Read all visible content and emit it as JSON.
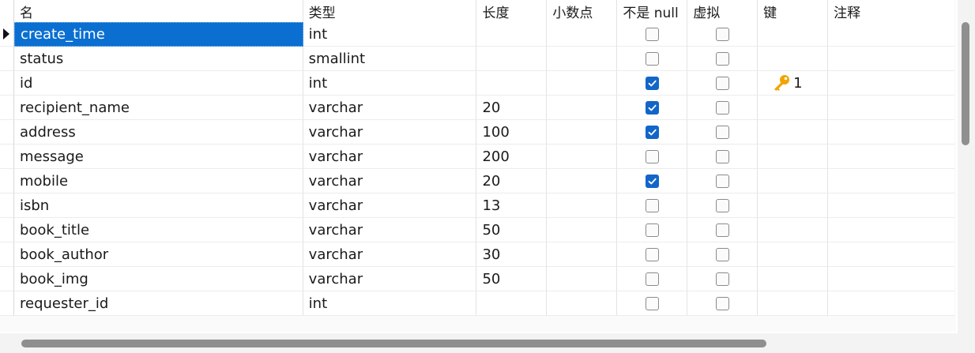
{
  "columns": {
    "name": "名",
    "type": "类型",
    "length": "长度",
    "decimals": "小数点",
    "not_null": "不是 null",
    "virtual": "虚拟",
    "key": "键",
    "comment": "注释"
  },
  "rows": [
    {
      "name": "create_time",
      "type": "int",
      "length": "",
      "decimals": "",
      "not_null": false,
      "virtual": false,
      "key": "",
      "comment": "",
      "selected": true
    },
    {
      "name": "status",
      "type": "smallint",
      "length": "",
      "decimals": "",
      "not_null": false,
      "virtual": false,
      "key": "",
      "comment": ""
    },
    {
      "name": "id",
      "type": "int",
      "length": "",
      "decimals": "",
      "not_null": true,
      "virtual": false,
      "key": "1",
      "comment": ""
    },
    {
      "name": "recipient_name",
      "type": "varchar",
      "length": "20",
      "decimals": "",
      "not_null": true,
      "virtual": false,
      "key": "",
      "comment": ""
    },
    {
      "name": "address",
      "type": "varchar",
      "length": "100",
      "decimals": "",
      "not_null": true,
      "virtual": false,
      "key": "",
      "comment": ""
    },
    {
      "name": "message",
      "type": "varchar",
      "length": "200",
      "decimals": "",
      "not_null": false,
      "virtual": false,
      "key": "",
      "comment": ""
    },
    {
      "name": "mobile",
      "type": "varchar",
      "length": "20",
      "decimals": "",
      "not_null": true,
      "virtual": false,
      "key": "",
      "comment": ""
    },
    {
      "name": "isbn",
      "type": "varchar",
      "length": "13",
      "decimals": "",
      "not_null": false,
      "virtual": false,
      "key": "",
      "comment": ""
    },
    {
      "name": "book_title",
      "type": "varchar",
      "length": "50",
      "decimals": "",
      "not_null": false,
      "virtual": false,
      "key": "",
      "comment": ""
    },
    {
      "name": "book_author",
      "type": "varchar",
      "length": "30",
      "decimals": "",
      "not_null": false,
      "virtual": false,
      "key": "",
      "comment": ""
    },
    {
      "name": "book_img",
      "type": "varchar",
      "length": "50",
      "decimals": "",
      "not_null": false,
      "virtual": false,
      "key": "",
      "comment": ""
    },
    {
      "name": "requester_id",
      "type": "int",
      "length": "",
      "decimals": "",
      "not_null": false,
      "virtual": false,
      "key": "",
      "comment": ""
    }
  ],
  "colors": {
    "selection": "#0a6fd1",
    "checkbox_checked": "#1266c9",
    "key_icon": "#f0a500"
  },
  "icons": {
    "row_indicator": "triangle-right-icon",
    "primary_key": "key-icon"
  }
}
